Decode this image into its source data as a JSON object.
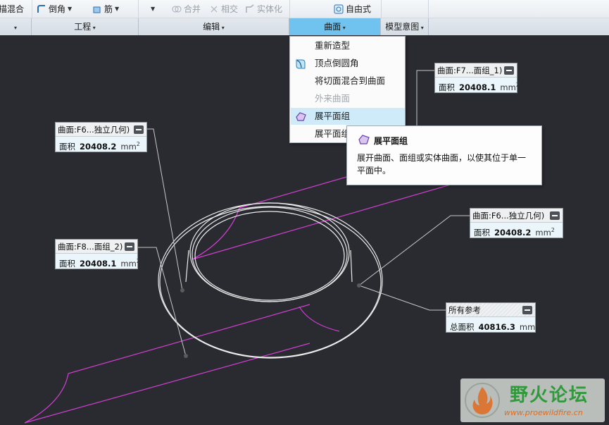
{
  "ribbon": {
    "row1": {
      "sweep_blend": "描混合",
      "round": "倒角",
      "rib": "筋",
      "merge": "合并",
      "intersect": "相交",
      "solidify": "实体化",
      "freestyle": "自由式"
    },
    "groups": {
      "engineering": "工程",
      "editing": "编辑",
      "surfaces": "曲面",
      "model_intent": "模型意图"
    }
  },
  "menu": {
    "items": [
      {
        "label": "重新造型",
        "enabled": true
      },
      {
        "label": "顶点倒圆角",
        "enabled": true
      },
      {
        "label": "将切面混合到曲面",
        "enabled": true
      },
      {
        "label": "外来曲面",
        "enabled": false
      },
      {
        "label": "展平面组",
        "enabled": true,
        "highlighted": true
      },
      {
        "label": "展平面组",
        "enabled": true
      }
    ]
  },
  "tooltip": {
    "title": "展平面组",
    "description": "展开曲面、面组或实体曲面，以使其位于单一平面中。"
  },
  "annotations": [
    {
      "title": "曲面:F6...独立几何)",
      "label": "面积",
      "value": "20408.2",
      "unit": "mm"
    },
    {
      "title": "曲面:F8...面组_2)",
      "label": "面积",
      "value": "20408.1",
      "unit": "mm"
    },
    {
      "title": "曲面:F7...面组_1)",
      "label": "面积",
      "value": "20408.1",
      "unit": "mm"
    },
    {
      "title": "曲面:F6...独立几何)",
      "label": "面积",
      "value": "20408.2",
      "unit": "mm"
    },
    {
      "title": "所有参考",
      "label": "总面积",
      "value": "40816.3",
      "unit": "mm"
    }
  ],
  "unit_power": "2",
  "watermark": {
    "title": "野火论坛",
    "url": "www.proewildfire.cn"
  },
  "colors": {
    "accent": "#6fc3ee",
    "sketch": "#d040d0",
    "viewport": "#2a2a31"
  }
}
